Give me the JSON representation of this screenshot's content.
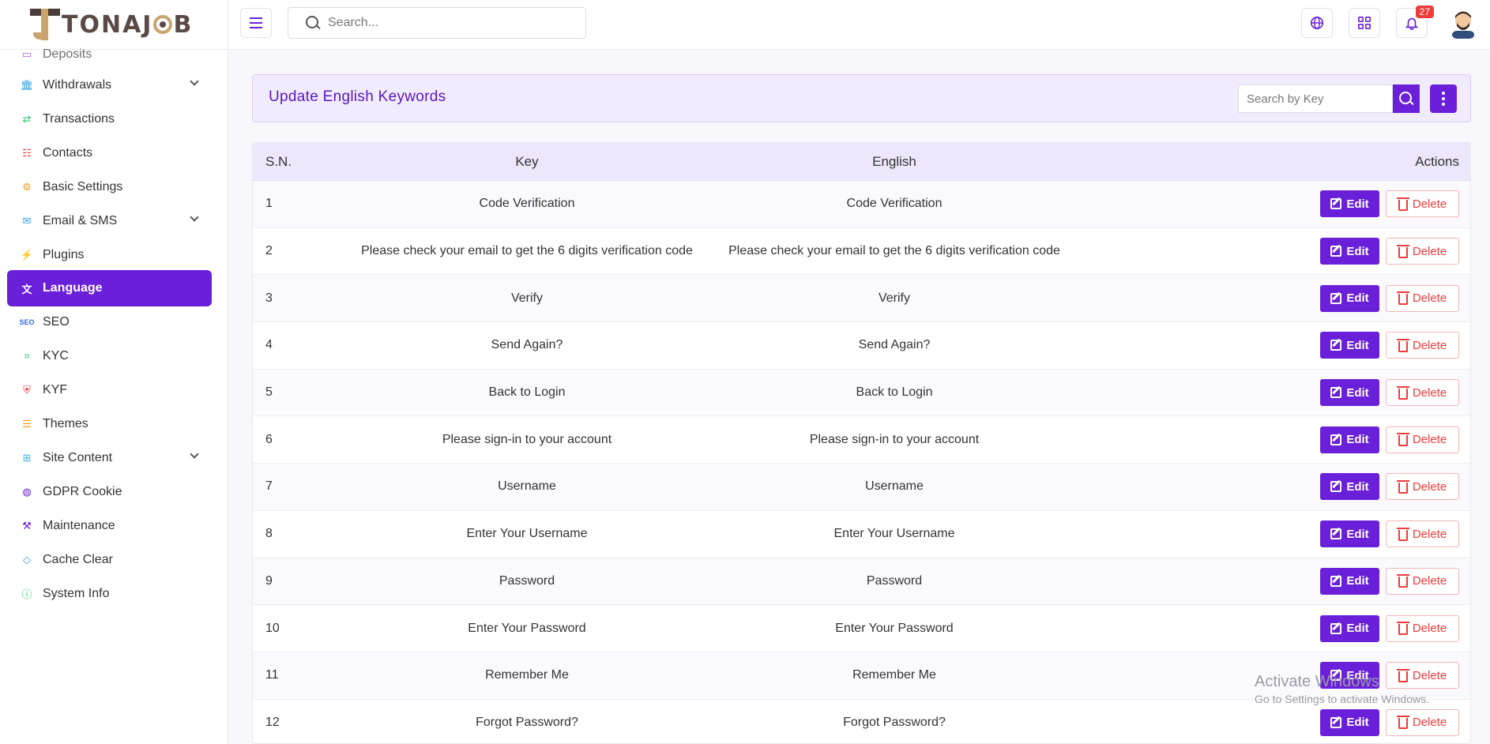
{
  "brand": {
    "name_left": "TONAJ",
    "name_right": "B"
  },
  "header": {
    "search_placeholder": "Search...",
    "notifications_count": "27"
  },
  "sidebar": {
    "items": [
      {
        "label": "Deposits",
        "icon": "wallet-icon",
        "color": "#6a1fd9"
      },
      {
        "label": "Withdrawals",
        "icon": "bank-icon",
        "color": "#2f9ee0",
        "expandable": true
      },
      {
        "label": "Transactions",
        "icon": "swap-icon",
        "color": "#1bc36b"
      },
      {
        "label": "Contacts",
        "icon": "contacts-icon",
        "color": "#ef3b3b"
      },
      {
        "label": "Basic Settings",
        "icon": "gear-icon",
        "color": "#f59b23"
      },
      {
        "label": "Email & SMS",
        "icon": "mail-icon",
        "color": "#2f9ee0",
        "expandable": true
      },
      {
        "label": "Plugins",
        "icon": "plug-icon",
        "color": "#6a1fd9"
      },
      {
        "label": "Language",
        "icon": "translate-icon",
        "active": true
      },
      {
        "label": "SEO",
        "icon": "seo-icon",
        "color": "#2f6fe0"
      },
      {
        "label": "KYC",
        "icon": "scan-face-icon",
        "color": "#1bc36b"
      },
      {
        "label": "KYF",
        "icon": "shield-user-icon",
        "color": "#ef3b3b"
      },
      {
        "label": "Themes",
        "icon": "list-icon",
        "color": "#f59b23"
      },
      {
        "label": "Site Content",
        "icon": "grid-plus-icon",
        "color": "#2fb8e0",
        "expandable": true
      },
      {
        "label": "GDPR Cookie",
        "icon": "cookie-icon",
        "color": "#6a1fd9"
      },
      {
        "label": "Maintenance",
        "icon": "wrench-icon",
        "color": "#6a1fd9"
      },
      {
        "label": "Cache Clear",
        "icon": "eraser-icon",
        "color": "#2f9ee0"
      },
      {
        "label": "System Info",
        "icon": "info-icon",
        "color": "#1bc36b"
      }
    ]
  },
  "page": {
    "title": "Update English Keywords",
    "key_search_placeholder": "Search by Key"
  },
  "table": {
    "headers": {
      "sn": "S.N.",
      "key": "Key",
      "english": "English",
      "actions": "Actions"
    },
    "edit_label": "Edit",
    "delete_label": "Delete",
    "rows": [
      {
        "sn": "1",
        "key": "Code Verification",
        "english": "Code Verification"
      },
      {
        "sn": "2",
        "key": "Please check your email to get the 6 digits verification code",
        "english": "Please check your email to get the 6 digits verification code"
      },
      {
        "sn": "3",
        "key": "Verify",
        "english": "Verify"
      },
      {
        "sn": "4",
        "key": "Send Again?",
        "english": "Send Again?"
      },
      {
        "sn": "5",
        "key": "Back to Login",
        "english": "Back to Login"
      },
      {
        "sn": "6",
        "key": "Please sign-in to your account",
        "english": "Please sign-in to your account"
      },
      {
        "sn": "7",
        "key": "Username",
        "english": "Username"
      },
      {
        "sn": "8",
        "key": "Enter Your Username",
        "english": "Enter Your Username"
      },
      {
        "sn": "9",
        "key": "Password",
        "english": "Password"
      },
      {
        "sn": "10",
        "key": "Enter Your Password",
        "english": "Enter Your Password"
      },
      {
        "sn": "11",
        "key": "Remember Me",
        "english": "Remember Me"
      },
      {
        "sn": "12",
        "key": "Forgot Password?",
        "english": "Forgot Password?"
      }
    ]
  },
  "watermark": {
    "title": "Activate Windows",
    "subtitle": "Go to Settings to activate Windows."
  },
  "colors": {
    "accent": "#6a1fd9",
    "danger": "#ef3b3b",
    "title_bg": "#f1ecfd"
  }
}
